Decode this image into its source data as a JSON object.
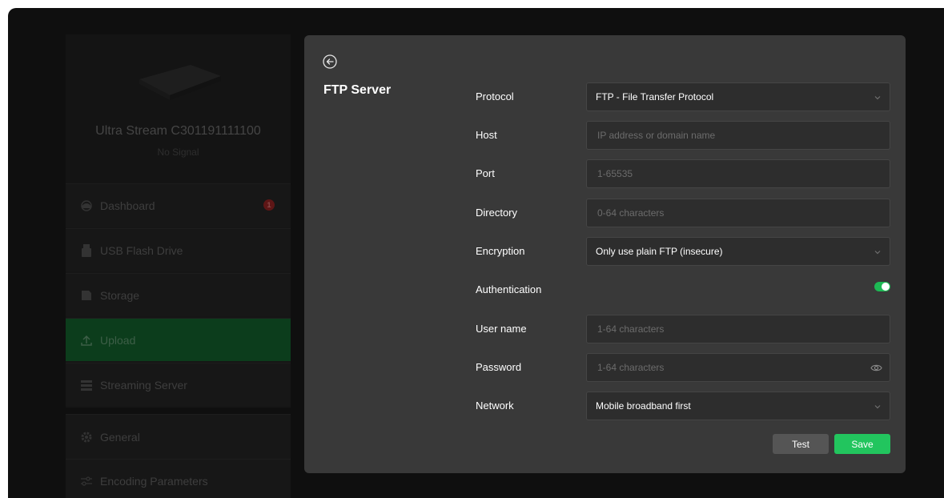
{
  "device": {
    "name": "Ultra Stream C301191111100",
    "status": "No Signal"
  },
  "sidebar": {
    "items": [
      {
        "label": "Dashboard",
        "icon": "dashboard-icon",
        "badge": "1"
      },
      {
        "label": "USB Flash Drive",
        "icon": "usb-drive-icon"
      },
      {
        "label": "Storage",
        "icon": "storage-icon"
      },
      {
        "label": "Upload",
        "icon": "upload-icon",
        "active": true
      },
      {
        "label": "Streaming Server",
        "icon": "streaming-server-icon"
      },
      {
        "label": "General",
        "icon": "gear-icon"
      },
      {
        "label": "Encoding Parameters",
        "icon": "sliders-icon"
      }
    ]
  },
  "panel": {
    "title": "FTP Server",
    "fields": {
      "protocol": {
        "label": "Protocol",
        "value": "FTP - File Transfer Protocol"
      },
      "host": {
        "label": "Host",
        "placeholder": "IP address or domain name"
      },
      "port": {
        "label": "Port",
        "placeholder": "1-65535"
      },
      "directory": {
        "label": "Directory",
        "placeholder": "0-64 characters"
      },
      "encryption": {
        "label": "Encryption",
        "value": "Only use plain FTP (insecure)"
      },
      "authentication": {
        "label": "Authentication",
        "enabled": true
      },
      "username": {
        "label": "User name",
        "placeholder": "1-64 characters"
      },
      "password": {
        "label": "Password",
        "placeholder": "1-64 characters"
      },
      "network": {
        "label": "Network",
        "value": "Mobile broadband first"
      }
    },
    "buttons": {
      "test": "Test",
      "save": "Save"
    }
  },
  "colors": {
    "accent": "#22c55e",
    "panel_bg": "#393939",
    "field_bg": "#2d2d2d"
  }
}
